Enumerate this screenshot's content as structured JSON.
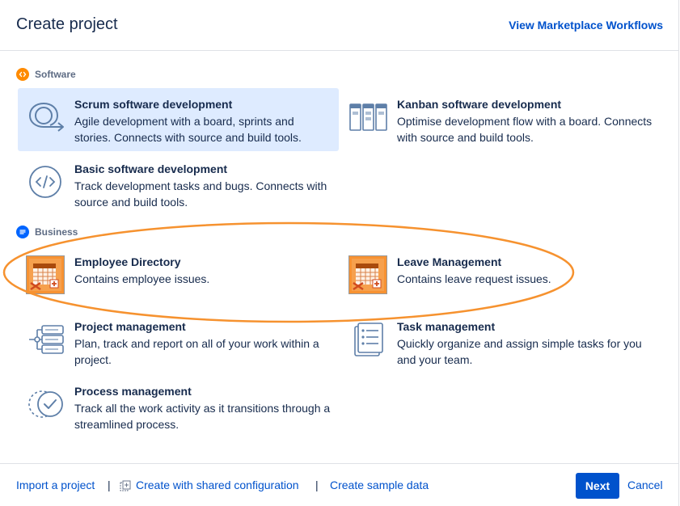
{
  "header": {
    "title": "Create project",
    "marketplace_link": "View Marketplace Workflows"
  },
  "sections": {
    "software": {
      "label": "Software",
      "items": [
        {
          "name": "Scrum software development",
          "description": "Agile development with a board, sprints and stories. Connects with source and build tools.",
          "icon": "scrum-icon",
          "selected": true
        },
        {
          "name": "Kanban software development",
          "description": "Optimise development flow with a board. Connects with source and build tools.",
          "icon": "kanban-icon"
        },
        {
          "name": "Basic software development",
          "description": "Track development tasks and bugs. Connects with source and build tools.",
          "icon": "code-icon"
        }
      ]
    },
    "business": {
      "label": "Business",
      "items": [
        {
          "name": "Employee Directory",
          "description": "Contains employee issues.",
          "icon": "calendar-icon"
        },
        {
          "name": "Leave Management",
          "description": "Contains leave request issues.",
          "icon": "calendar-icon"
        },
        {
          "name": "Project management",
          "description": "Plan, track and report on all of your work within a project.",
          "icon": "project-management-icon"
        },
        {
          "name": "Task management",
          "description": "Quickly organize and assign simple tasks for you and your team.",
          "icon": "task-list-icon"
        },
        {
          "name": "Process management",
          "description": "Track all the work activity as it transitions through a streamlined process.",
          "icon": "process-check-icon"
        }
      ]
    }
  },
  "footer": {
    "import_link": "Import a project",
    "separator": "|",
    "shared_config_link": "Create with shared configuration",
    "sample_data_link": "Create sample data",
    "next_button": "Next",
    "cancel_link": "Cancel"
  },
  "colors": {
    "accent": "#0052cc",
    "selected_bg": "#deebff",
    "software_badge": "#ff8b00",
    "business_badge": "#0065ff",
    "highlight_ellipse": "#f6922f",
    "calendar_icon": "#f79232"
  }
}
